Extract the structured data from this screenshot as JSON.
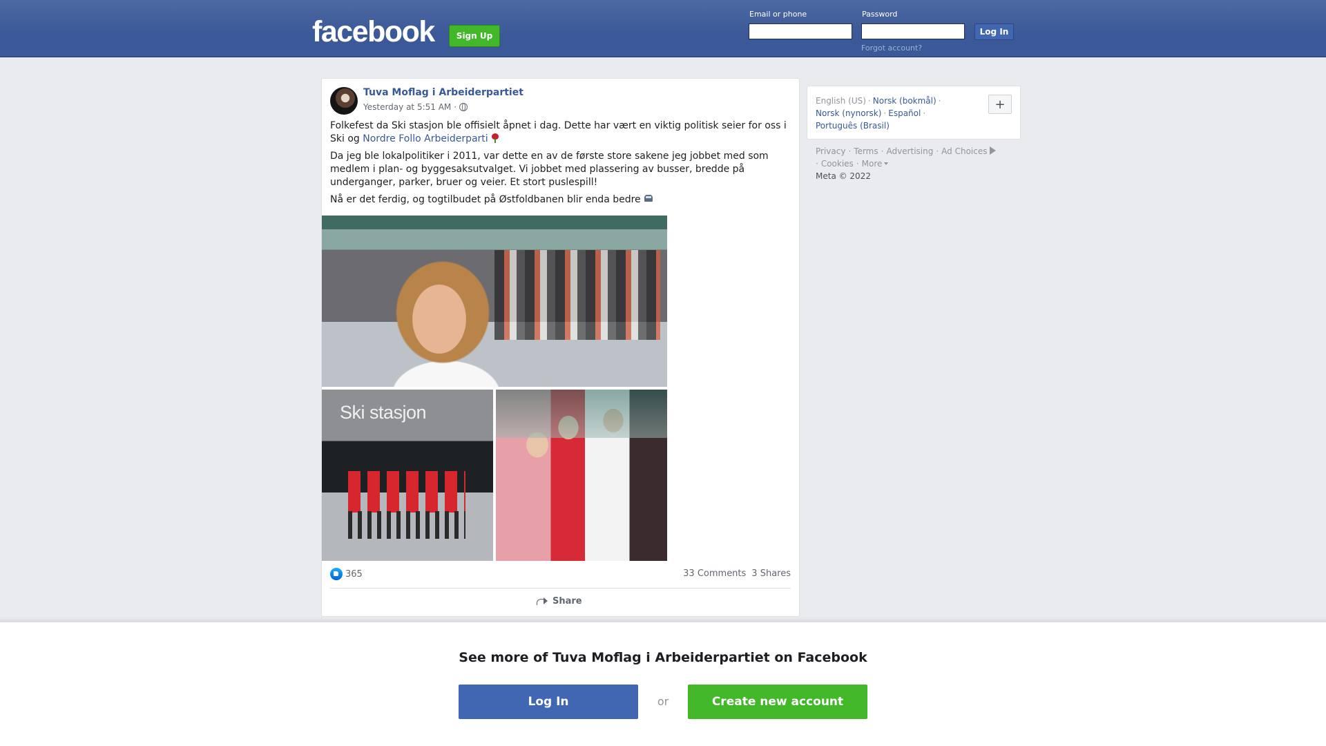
{
  "header": {
    "logo": "facebook",
    "signup_label": "Sign Up",
    "email_label": "Email or phone",
    "email_value": "",
    "password_label": "Password",
    "password_value": "",
    "login_label": "Log In",
    "forgot_label": "Forgot account?"
  },
  "post": {
    "author": "Tuva Moflag i Arbeiderpartiet",
    "timestamp": "Yesterday at 5:51 AM",
    "separator": "·",
    "paragraph1_text": "Folkefest da Ski stasjon ble offisielt åpnet i dag. Dette har vært en viktig politisk seier for oss i Ski og ",
    "paragraph1_link": "Nordre Follo Arbeiderparti",
    "paragraph2": "Da jeg ble lokalpolitiker i 2011, var dette en av de første store sakene jeg jobbet med som medlem i plan- og byggesaksutvalget. Vi jobbet med plassering av busser, bredde på underganger, parker, bruer og veier. Et stort puslespill!",
    "paragraph3": "Nå er det ferdig, og togtilbudet på Østfoldbanen blir enda bedre",
    "photo_sign": "Ski stasjon",
    "reaction_count": "365",
    "comments": "33 Comments",
    "shares": "3 Shares",
    "share_label": "Share"
  },
  "sidebar": {
    "current_language": "English (US)",
    "languages": [
      "Norsk (bokmål)",
      "Norsk (nynorsk)",
      "Español",
      "Português (Brasil)"
    ],
    "plus_label": "+",
    "footer_links": [
      "Privacy",
      "Terms",
      "Advertising",
      "Ad Choices",
      "Cookies",
      "More"
    ],
    "copyright": "Meta © 2022"
  },
  "banner": {
    "title": "See more of Tuva Moflag i Arbeiderpartiet on Facebook",
    "login_label": "Log In",
    "or_label": "or",
    "create_label": "Create new account"
  },
  "colors": {
    "brand_blue": "#3b5998",
    "button_blue": "#4267b2",
    "green": "#42b72a",
    "link": "#385898"
  },
  "icons": [
    "globe-icon",
    "rose-icon",
    "train-icon",
    "like-icon",
    "share-icon",
    "adchoices-icon",
    "caret-icon"
  ]
}
